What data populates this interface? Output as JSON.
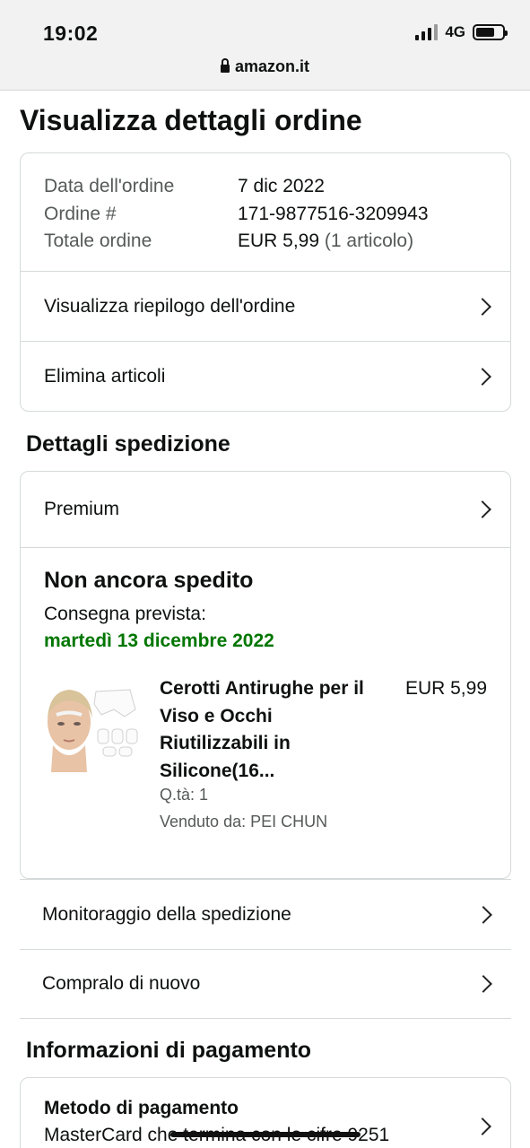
{
  "status_bar": {
    "time": "19:02",
    "network": "4G"
  },
  "browser": {
    "url": "amazon.it"
  },
  "page": {
    "title": "Visualizza dettagli ordine"
  },
  "order": {
    "date_label": "Data dell'ordine",
    "date_value": "7 dic 2022",
    "number_label": "Ordine #",
    "number_value": "171-9877516-3209943",
    "total_label": "Totale ordine",
    "total_value": "EUR 5,99",
    "total_items": "(1 articolo)",
    "summary_link": "Visualizza riepilogo dell'ordine",
    "delete_link": "Elimina articoli"
  },
  "shipping": {
    "heading": "Dettagli spedizione",
    "method": "Premium",
    "status": "Non ancora spedito",
    "delivery_label": "Consegna prevista:",
    "delivery_date": "martedì 13 dicembre 2022",
    "item": {
      "title": "Cerotti Antirughe per il Viso e Occhi Riutilizzabili in Silicone(16...",
      "price": "EUR 5,99",
      "qty": "Q.tà: 1",
      "seller": "Venduto da: PEI CHUN"
    },
    "track_link": "Monitoraggio della spedizione",
    "buy_again_link": "Compralo di nuovo"
  },
  "payment": {
    "heading": "Informazioni di pagamento",
    "method_label": "Metodo di pagamento",
    "method_value": "MasterCard che termina con le cifre 9251"
  },
  "colors": {
    "green_date": "#007600",
    "border": "#d5d9d9",
    "muted": "#565959"
  }
}
